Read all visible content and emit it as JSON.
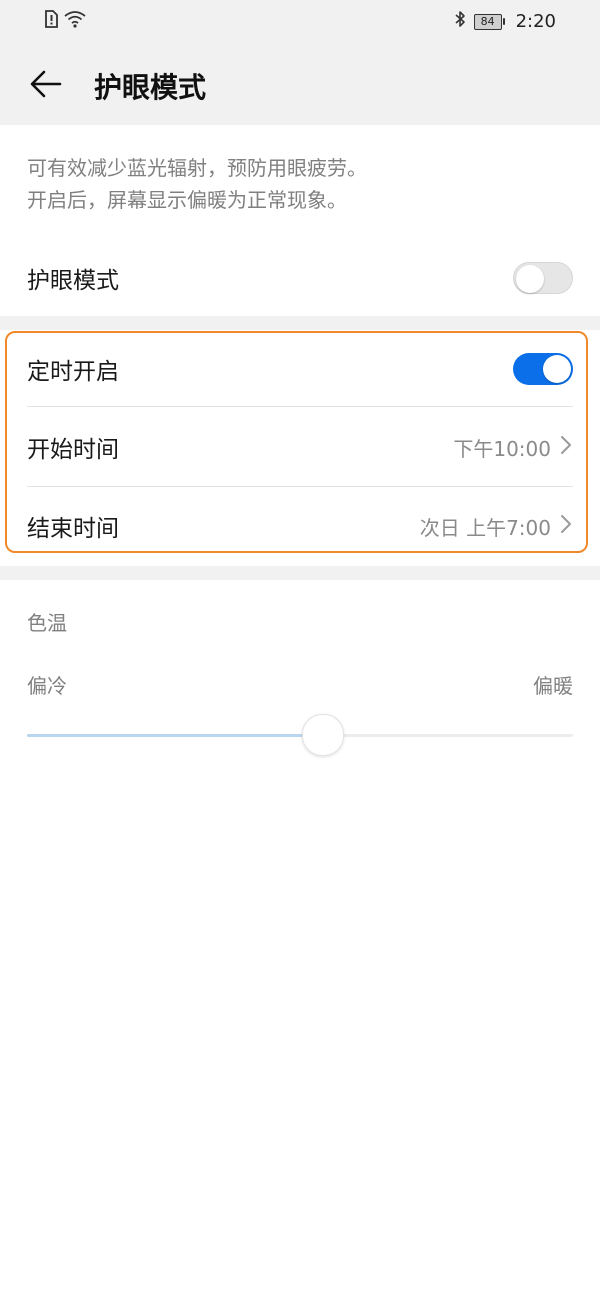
{
  "status_bar": {
    "time": "2:20",
    "battery_level": "84",
    "icons": [
      "sim-alert-icon",
      "wifi-icon",
      "bluetooth-icon",
      "battery-icon"
    ]
  },
  "header": {
    "title": "护眼模式",
    "back_icon": "back-arrow-icon"
  },
  "description": {
    "line1": "可有效减少蓝光辐射，预防用眼疲劳。",
    "line2": "开启后，屏幕显示偏暖为正常现象。"
  },
  "eye_care": {
    "label": "护眼模式",
    "enabled": false
  },
  "schedule": {
    "label": "定时开启",
    "enabled": true,
    "start_label": "开始时间",
    "start_value": "下午10:00",
    "end_label": "结束时间",
    "end_value": "次日 上午7:00"
  },
  "color_temp": {
    "title": "色温",
    "min_label": "偏冷",
    "max_label": "偏暖",
    "value_fraction": 0.54
  },
  "colors": {
    "accent": "#0a6fe8",
    "highlight": "#ef8a2c",
    "background_gray": "#f1f1f1"
  }
}
